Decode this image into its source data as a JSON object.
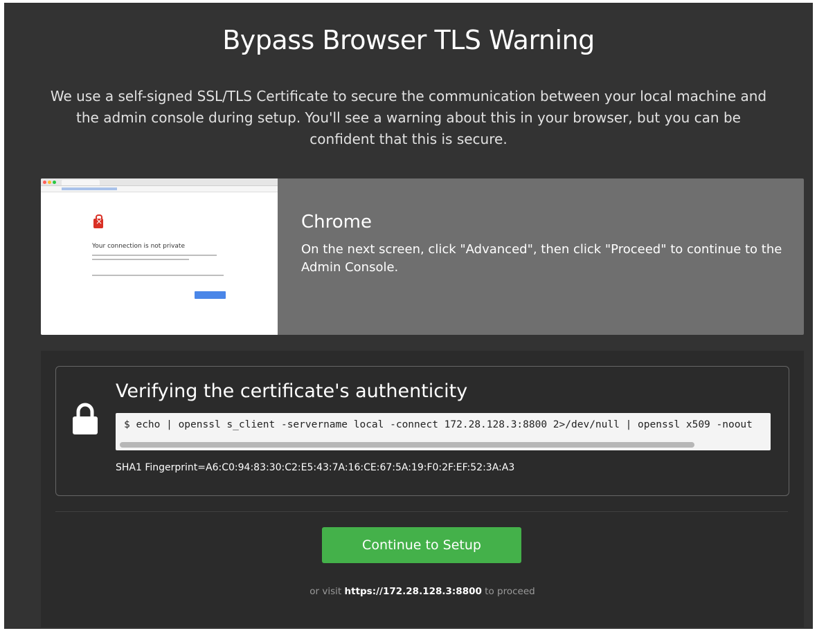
{
  "page": {
    "title": "Bypass Browser TLS Warning",
    "intro": "We use a self-signed SSL/TLS Certificate to secure the communication between your local machine and the admin console during setup. You'll see a warning about this in your browser, but you can be confident that this is secure."
  },
  "browser": {
    "name": "Chrome",
    "instructions": "On the next screen, click \"Advanced\", then click \"Proceed\" to continue to the Admin Console.",
    "thumbnail_heading": "Your connection is not private"
  },
  "verify": {
    "title": "Verifying the certificate's authenticity",
    "command": "$ echo | openssl s_client -servername local -connect 172.28.128.3:8800 2>/dev/null | openssl x509 -noout",
    "fingerprint": "SHA1 Fingerprint=A6:C0:94:83:30:C2:E5:43:7A:16:CE:67:5A:19:F0:2F:EF:52:3A:A3",
    "icon": "lock-icon"
  },
  "actions": {
    "continue_label": "Continue to Setup",
    "visit_prefix": "or visit",
    "visit_url": "https://172.28.128.3:8800",
    "visit_suffix": "to proceed"
  },
  "colors": {
    "background": "#333333",
    "card": "#6f6f6f",
    "panel": "#2b2b2b",
    "button": "#44b14a"
  }
}
